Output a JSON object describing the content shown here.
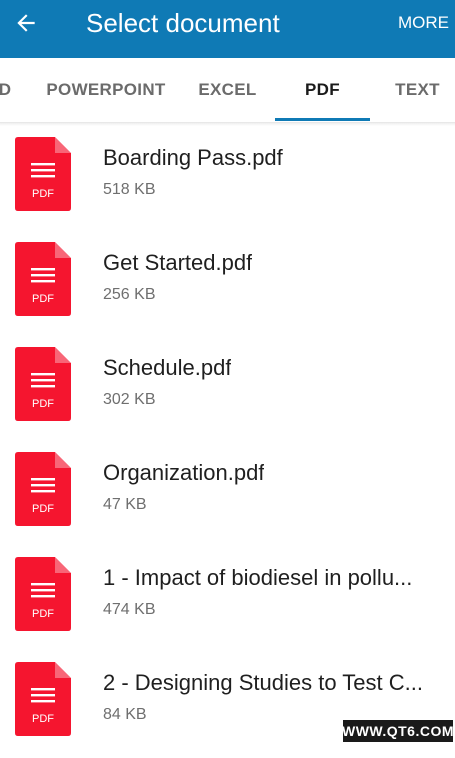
{
  "appbar": {
    "back_icon": "arrow-left-icon",
    "title": "Select document",
    "more_label": "MORE",
    "color": "#0f7ab5"
  },
  "tabs": [
    {
      "label": "D",
      "active": false
    },
    {
      "label": "POWERPOINT",
      "active": false
    },
    {
      "label": "EXCEL",
      "active": false
    },
    {
      "label": "PDF",
      "active": true
    },
    {
      "label": "TEXT",
      "active": false
    }
  ],
  "files": [
    {
      "name": "Boarding Pass.pdf",
      "size": "518 KB",
      "icon": "pdf-file-icon",
      "icon_label": "PDF"
    },
    {
      "name": "Get Started.pdf",
      "size": "256 KB",
      "icon": "pdf-file-icon",
      "icon_label": "PDF"
    },
    {
      "name": "Schedule.pdf",
      "size": "302 KB",
      "icon": "pdf-file-icon",
      "icon_label": "PDF"
    },
    {
      "name": "Organization.pdf",
      "size": "47 KB",
      "icon": "pdf-file-icon",
      "icon_label": "PDF"
    },
    {
      "name": "1 - Impact of biodiesel in pollu...",
      "size": "474 KB",
      "icon": "pdf-file-icon",
      "icon_label": "PDF"
    },
    {
      "name": "2 - Designing Studies to Test C...",
      "size": "84 KB",
      "icon": "pdf-file-icon",
      "icon_label": "PDF"
    }
  ],
  "pdf_icon_color": "#f5152f",
  "watermark": "WWW.QT6.COM"
}
